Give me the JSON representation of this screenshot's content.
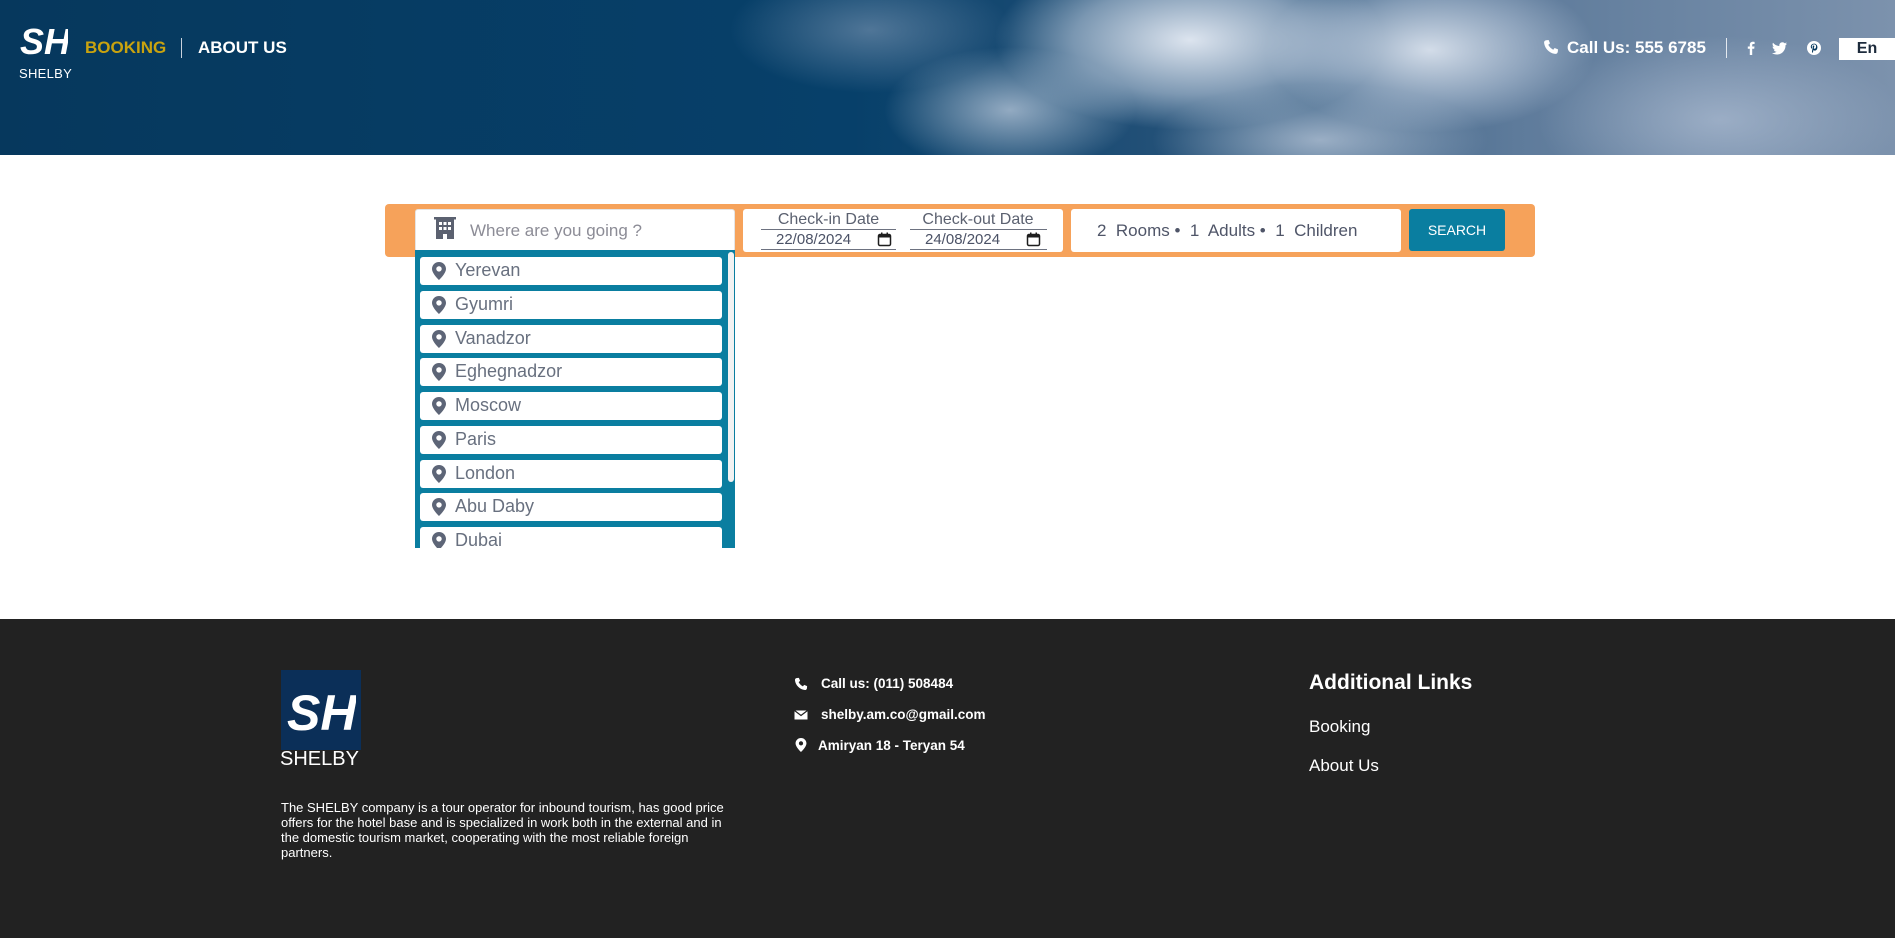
{
  "header": {
    "logo_text": "SHELBY",
    "nav": {
      "booking": "BOOKING",
      "about": "ABOUT US"
    },
    "call": "Call Us: 555 6785",
    "social_icons": [
      "facebook-icon",
      "twitter-icon",
      "pinterest-icon"
    ],
    "language": "En"
  },
  "search": {
    "destination_placeholder": "Where are you going ?",
    "checkin_label": "Check-in Date",
    "checkin_value": "22/08/2024",
    "checkout_label": "Check-out Date",
    "checkout_value": "24/08/2024",
    "guests_summary": "2  Rooms •  1  Adults •  1  Children",
    "search_button": "SEARCH"
  },
  "dropdown": {
    "items": [
      "Yerevan",
      "Gyumri",
      "Vanadzor",
      "Eghegnadzor",
      "Moscow",
      "Paris",
      "London",
      "Abu Daby",
      "Dubai"
    ]
  },
  "footer": {
    "logo_text": "SHELBY",
    "description": "The SHELBY company is a tour operator for inbound tourism, has good price offers for the hotel base and is specialized in work both in the external and in the domestic tourism market, cooperating with the most reliable foreign partners.",
    "phone": "Call us: (011) 508484",
    "email": "shelby.am.co@gmail.com",
    "address": "Amiryan 18 - Teryan 54",
    "links_title": "Additional Links",
    "links": [
      "Booking",
      "About Us"
    ]
  },
  "colors": {
    "accent_orange": "#f6a25a",
    "teal": "#0a7ea0",
    "nav_active": "#c9a30f",
    "footer_bg": "#222222",
    "header_navy": "#06385d"
  }
}
